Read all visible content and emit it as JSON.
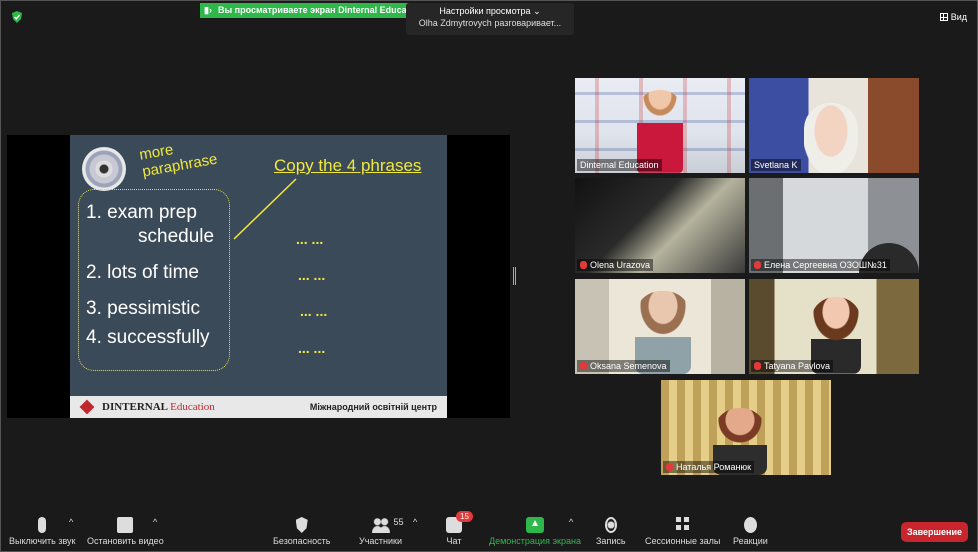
{
  "topbar": {
    "share_banner": "Вы просматриваете экран Dinternal Education",
    "view_options_title": "Настройки просмотра",
    "view_options_caret": "⌄",
    "speaking_status": "Olha Zdmytrovych разговаривает...",
    "view_button": "Вид"
  },
  "slide": {
    "more_line1": "more",
    "more_line2": "paraphrase",
    "copy_text": "Copy the 4 phrases",
    "items": [
      {
        "text": "1.  exam prep",
        "cont": "schedule"
      },
      {
        "text": "2. lots of time"
      },
      {
        "text": "3. pessimistic"
      },
      {
        "text": "4. successfully"
      }
    ],
    "dots": "... ...",
    "footer_brand": "DINTERNAL",
    "footer_brand_accent": "Education",
    "footer_center": "Міжнародний освітній центр"
  },
  "participants": [
    {
      "name": "Dinternal Education",
      "muted": false
    },
    {
      "name": "Svetlana K",
      "muted": false
    },
    {
      "name": "Olena Urazova",
      "muted": true
    },
    {
      "name": "Елена Сергеевна ОЗОШ№31",
      "muted": true
    },
    {
      "name": "Oksana Semenova",
      "muted": true
    },
    {
      "name": "Tatyana Pavlova",
      "muted": true
    },
    {
      "name": "Наталья Романюк",
      "muted": true
    }
  ],
  "toolbar": {
    "mute_label": "Выключить звук",
    "video_label": "Остановить видео",
    "security_label": "Безопасность",
    "participants_label": "Участники",
    "participants_count": "55",
    "chat_label": "Чат",
    "chat_badge": "15",
    "share_label": "Демонстрация экрана",
    "record_label": "Запись",
    "rooms_label": "Сессионные залы",
    "reactions_label": "Реакции",
    "end_label": "Завершение",
    "caret": "^"
  },
  "colors": {
    "accent_green": "#2fb84a",
    "end_red": "#c9252d",
    "slide_bg": "#3b4a58",
    "slide_yellow": "#f0e83c"
  }
}
